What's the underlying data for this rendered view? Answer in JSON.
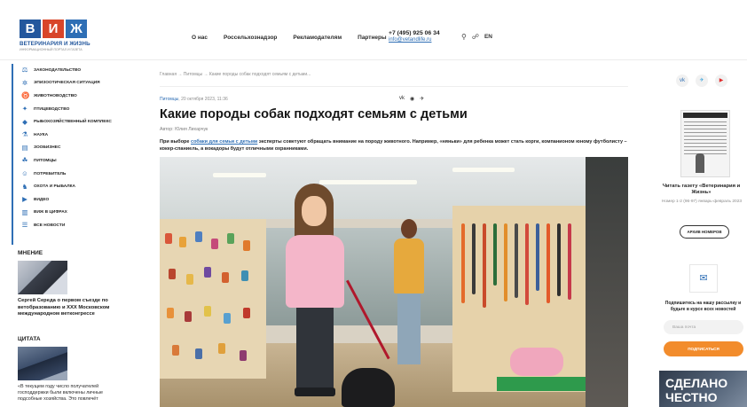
{
  "header": {
    "logo": {
      "letters": [
        "В",
        "И",
        "Ж"
      ],
      "name": "ВЕТЕРИНАРИЯ И ЖИЗНЬ",
      "tagline": "ИНФОРМАЦИОННЫЙ ПОРТАЛ И ГАЗЕТА"
    },
    "nav": [
      "О нас",
      "Россельхознадзор",
      "Рекламодателям",
      "Партнеры"
    ],
    "phone": "+7 (495) 925 06 34",
    "email": "info@vetandlife.ru",
    "language": "EN",
    "icons": [
      "search-icon",
      "rss-icon"
    ]
  },
  "sidebar": {
    "menu": [
      {
        "icon": "gavel-icon",
        "glyph": "⚖",
        "label": "Законодательство"
      },
      {
        "icon": "virus-icon",
        "glyph": "✲",
        "label": "Эпизоотическая ситуация"
      },
      {
        "icon": "cow-icon",
        "glyph": "♉",
        "label": "Животноводство"
      },
      {
        "icon": "paw-icon",
        "glyph": "✦",
        "label": "Птицеводство"
      },
      {
        "icon": "fish-icon",
        "glyph": "◆",
        "label": "Рыбохозяйственный комплекс"
      },
      {
        "icon": "flask-icon",
        "glyph": "⚗",
        "label": "Наука"
      },
      {
        "icon": "book-icon",
        "glyph": "▤",
        "label": "Зообизнес"
      },
      {
        "icon": "pet-icon",
        "glyph": "☘",
        "label": "Питомцы"
      },
      {
        "icon": "person-icon",
        "glyph": "☺",
        "label": "Потребитель"
      },
      {
        "icon": "hunt-icon",
        "glyph": "♞",
        "label": "Охота и рыбалка"
      },
      {
        "icon": "video-icon",
        "glyph": "▶",
        "label": "Видео"
      },
      {
        "icon": "chart-icon",
        "glyph": "▥",
        "label": "ВиЖ в цифрах"
      },
      {
        "icon": "news-icon",
        "glyph": "☰",
        "label": "Все новости"
      }
    ],
    "opinion_heading": "МНЕНИЕ",
    "opinion_text": "Сергей Середа о первом съезде по ветобразованию и XXX Московском международном ветконгрессе",
    "quote_heading": "ЦИТАТА",
    "quote_text": "«В текущем году число получателей господдержки были включены личные подсобные хозяйства. Это повлечёт"
  },
  "article": {
    "breadcrumb": "Главная  →  Питомцы  →  Какие породы собак подходят семьям с детьми...",
    "category": "Питомцы",
    "date": "20 октября 2023, 11:36",
    "share_icons": [
      "vk-icon",
      "odnoklassniki-icon",
      "telegram-icon"
    ],
    "title": "Какие породы собак подходят семьям с детьми",
    "author": "Автор: Юлия Лихарчук",
    "lead_prefix": "При выборе ",
    "lead_link": "собаки для семьи с детьми",
    "lead_suffix": " эксперты советуют обращать внимание на породу животного. Например, «няньки» для ребенка может стать корги, компанионом юному футболисту – кокер-спаниель, а вокадоры будут отличными охранниками."
  },
  "right": {
    "socials": [
      {
        "icon": "vk-icon",
        "glyph": "vk"
      },
      {
        "icon": "telegram-icon",
        "glyph": "✈"
      },
      {
        "icon": "youtube-icon",
        "glyph": "▶"
      }
    ],
    "read_title": "Читать газету «Ветеринария и Жизнь»",
    "issue_no": "Номер 1-2 (96-97) январь-февраль 2023",
    "archive_button": "АРХИВ НОМЕРОВ",
    "subscribe_text": "Подпишитесь на нашу рассылку и будьте в курсе всех новостей",
    "email_placeholder": "Ваша почта",
    "subscribe_button": "ПОДПИСАТЬСЯ",
    "banner_text": "СДЕЛАНО ЧЕСТНО"
  },
  "colors": {
    "brand_blue": "#2f6fb5",
    "brand_red": "#d8452a",
    "accent_orange": "#f28c2c"
  }
}
